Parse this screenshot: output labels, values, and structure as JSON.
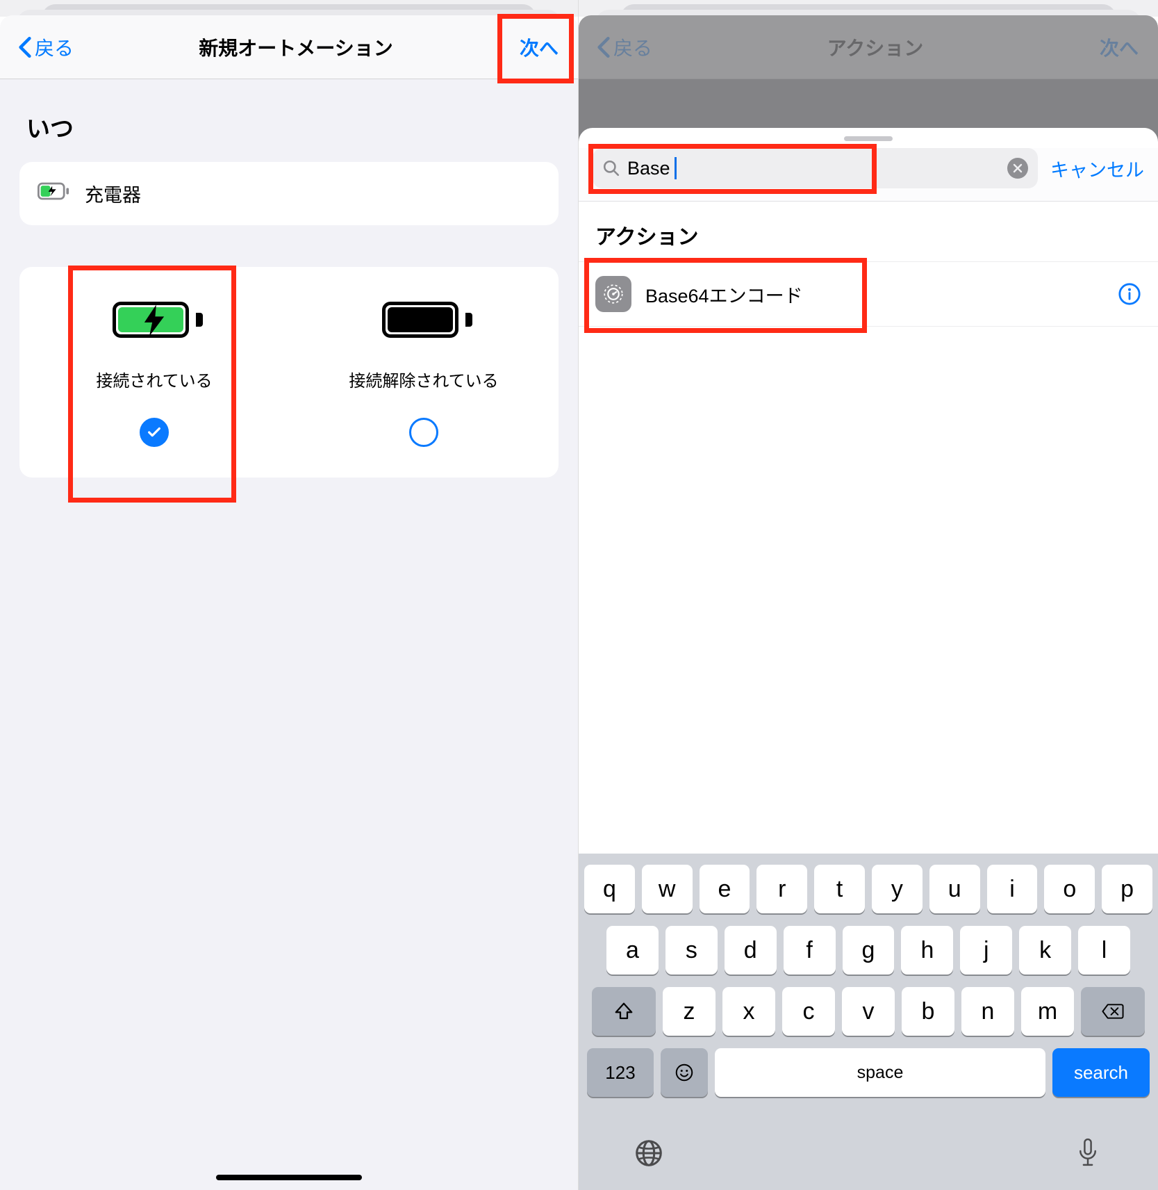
{
  "left": {
    "nav": {
      "back": "戻る",
      "title": "新規オートメーション",
      "next": "次へ"
    },
    "section": "いつ",
    "trigger": "充電器",
    "option_connected": "接続されている",
    "option_disconnected": "接続解除されている"
  },
  "right": {
    "nav": {
      "back": "戻る",
      "title": "アクション",
      "next": "次へ"
    },
    "search": {
      "value": "Base",
      "cancel": "キャンセル"
    },
    "section": "アクション",
    "actions": [
      {
        "label": "Base64エンコード"
      }
    ],
    "keyboard": {
      "row1": [
        "q",
        "w",
        "e",
        "r",
        "t",
        "y",
        "u",
        "i",
        "o",
        "p"
      ],
      "row2": [
        "a",
        "s",
        "d",
        "f",
        "g",
        "h",
        "j",
        "k",
        "l"
      ],
      "row3": [
        "z",
        "x",
        "c",
        "v",
        "b",
        "n",
        "m"
      ],
      "num": "123",
      "space": "space",
      "search": "search"
    }
  }
}
